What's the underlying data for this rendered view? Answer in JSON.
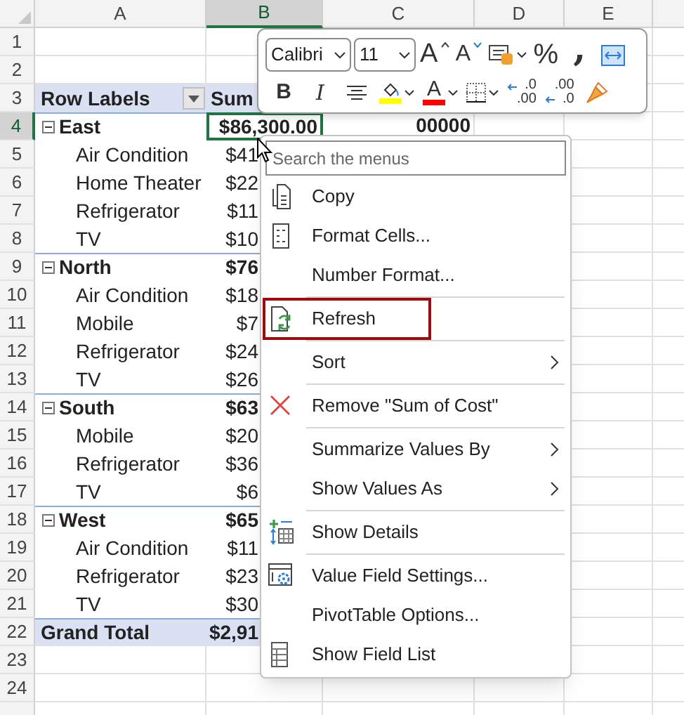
{
  "columns": [
    {
      "label": "A",
      "selected": false
    },
    {
      "label": "B",
      "selected": true
    },
    {
      "label": "C",
      "selected": false
    },
    {
      "label": "D",
      "selected": false
    },
    {
      "label": "E",
      "selected": false
    }
  ],
  "rows": [
    {
      "num": "1",
      "kind": "blank",
      "selected": false
    },
    {
      "num": "2",
      "kind": "blank",
      "selected": false
    },
    {
      "num": "3",
      "kind": "header",
      "label": "Row Labels",
      "value": "Sum",
      "selected": false
    },
    {
      "num": "4",
      "kind": "group",
      "label": "East",
      "value": "$86,300.00",
      "extra": "00000",
      "selected": true
    },
    {
      "num": "5",
      "kind": "item",
      "label": "Air Condition",
      "value": "$41",
      "selected": false
    },
    {
      "num": "6",
      "kind": "item",
      "label": "Home Theater",
      "value": "$22",
      "selected": false
    },
    {
      "num": "7",
      "kind": "item",
      "label": "Refrigerator",
      "value": "$11",
      "selected": false
    },
    {
      "num": "8",
      "kind": "item",
      "label": "TV",
      "value": "$10",
      "selected": false
    },
    {
      "num": "9",
      "kind": "group",
      "label": "North",
      "value": "$76",
      "selected": false
    },
    {
      "num": "10",
      "kind": "item",
      "label": "Air Condition",
      "value": "$18",
      "selected": false
    },
    {
      "num": "11",
      "kind": "item",
      "label": "Mobile",
      "value": "$7",
      "selected": false
    },
    {
      "num": "12",
      "kind": "item",
      "label": "Refrigerator",
      "value": "$24",
      "selected": false
    },
    {
      "num": "13",
      "kind": "item",
      "label": "TV",
      "value": "$26",
      "selected": false
    },
    {
      "num": "14",
      "kind": "group",
      "label": "South",
      "value": "$63",
      "selected": false
    },
    {
      "num": "15",
      "kind": "item",
      "label": "Mobile",
      "value": "$20",
      "selected": false
    },
    {
      "num": "16",
      "kind": "item",
      "label": "Refrigerator",
      "value": "$36",
      "selected": false
    },
    {
      "num": "17",
      "kind": "item",
      "label": "TV",
      "value": "$6",
      "selected": false
    },
    {
      "num": "18",
      "kind": "group",
      "label": "West",
      "value": "$65",
      "selected": false
    },
    {
      "num": "19",
      "kind": "item",
      "label": "Air Condition",
      "value": "$11",
      "selected": false
    },
    {
      "num": "20",
      "kind": "item",
      "label": "Refrigerator",
      "value": "$23",
      "selected": false
    },
    {
      "num": "21",
      "kind": "item",
      "label": "TV",
      "value": "$30",
      "selected": false
    },
    {
      "num": "22",
      "kind": "total",
      "label": "Grand Total",
      "value": "$2,91",
      "selected": false
    },
    {
      "num": "23",
      "kind": "blank",
      "selected": false
    },
    {
      "num": "24",
      "kind": "blank",
      "selected": false
    }
  ],
  "mini_toolbar": {
    "font": "Calibri",
    "size": "11",
    "row1": [
      {
        "kind": "grow",
        "glyph": "A"
      },
      {
        "kind": "shrink",
        "glyph": "A"
      },
      {
        "kind": "table"
      },
      {
        "kind": "percent",
        "glyph": "%"
      },
      {
        "kind": "comma",
        "glyph": ","
      },
      {
        "kind": "merge"
      }
    ],
    "row2": [
      {
        "kind": "bold",
        "glyph": "B"
      },
      {
        "kind": "italic",
        "glyph": "I"
      },
      {
        "kind": "align"
      },
      {
        "kind": "fill",
        "color": "#ffff00"
      },
      {
        "kind": "fontcolor",
        "glyph": "A",
        "color": "#ff0000"
      },
      {
        "kind": "borders"
      },
      {
        "kind": "incdec",
        "top": ".0",
        "bottom": ".00"
      },
      {
        "kind": "decdec",
        "top": ".00",
        "bottom": ".0"
      },
      {
        "kind": "painter"
      }
    ]
  },
  "context_menu": {
    "search": {
      "placeholder": "Search the menus"
    },
    "items": [
      {
        "label": "Copy",
        "kind": "copy",
        "submenu": false,
        "separator_before": false,
        "highlighted": false
      },
      {
        "label": "Format Cells...",
        "kind": "format",
        "submenu": false,
        "separator_before": false,
        "highlighted": false
      },
      {
        "label": "Number Format...",
        "kind": "plain",
        "submenu": false,
        "separator_before": false,
        "highlighted": false
      },
      {
        "label": "Refresh",
        "kind": "refresh",
        "submenu": false,
        "separator_before": true,
        "highlighted": true
      },
      {
        "label": "Sort",
        "kind": "plain",
        "submenu": true,
        "separator_before": true,
        "highlighted": false
      },
      {
        "label": "Remove \"Sum of Cost\"",
        "kind": "remove",
        "submenu": false,
        "separator_before": true,
        "highlighted": false
      },
      {
        "label": "Summarize Values By",
        "kind": "plain",
        "submenu": true,
        "separator_before": true,
        "highlighted": false
      },
      {
        "label": "Show Values As",
        "kind": "plain",
        "submenu": true,
        "separator_before": false,
        "highlighted": false
      },
      {
        "label": "Show Details",
        "kind": "details",
        "submenu": false,
        "separator_before": true,
        "highlighted": false
      },
      {
        "label": "Value Field Settings...",
        "kind": "settings",
        "submenu": false,
        "separator_before": true,
        "highlighted": false
      },
      {
        "label": "PivotTable Options...",
        "kind": "plain",
        "submenu": false,
        "separator_before": false,
        "highlighted": false
      },
      {
        "label": "Show Field List",
        "kind": "fieldlist",
        "submenu": false,
        "separator_before": false,
        "highlighted": false
      }
    ]
  }
}
